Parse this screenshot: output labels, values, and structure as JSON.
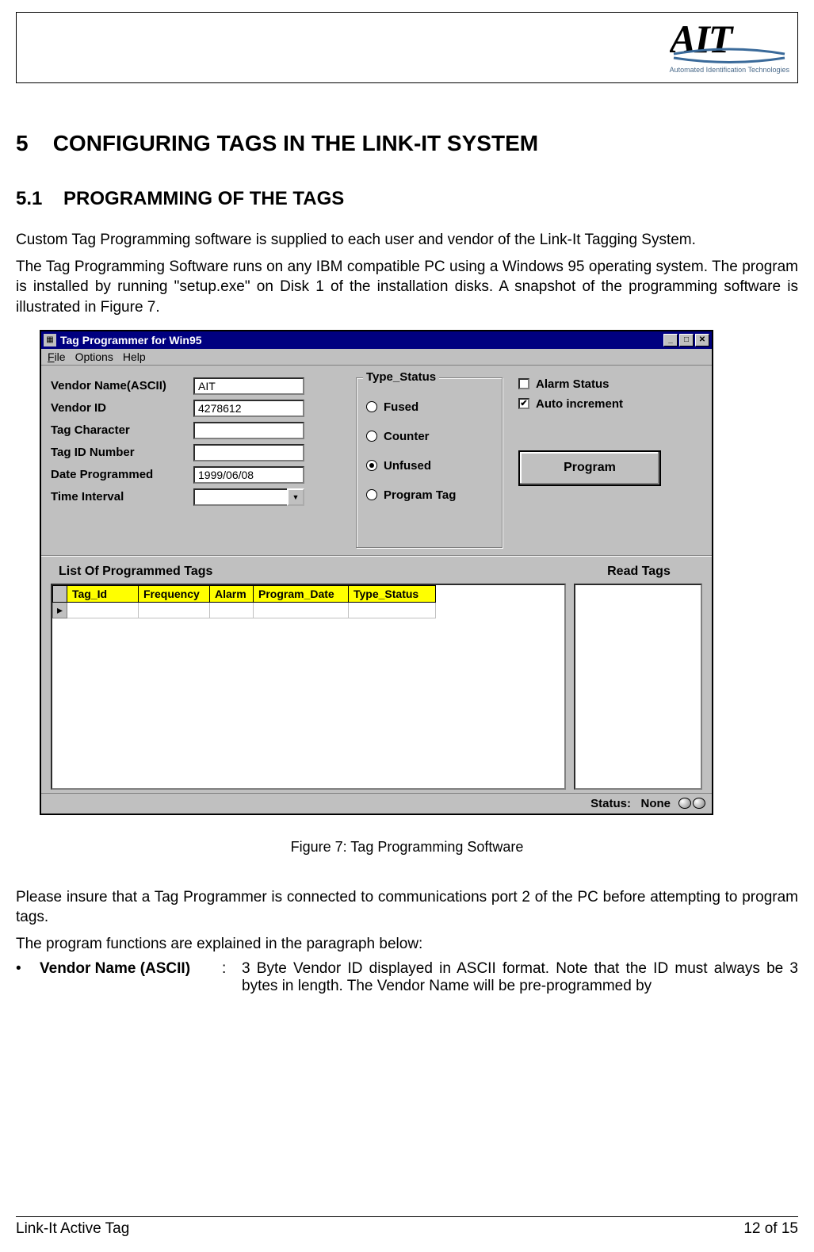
{
  "logo": {
    "main": "AIT",
    "sub": "Automated Identification Technologies"
  },
  "section": {
    "num": "5",
    "title": "CONFIGURING TAGS IN THE LINK-IT SYSTEM"
  },
  "subsection": {
    "num": "5.1",
    "title": "PROGRAMMING OF THE TAGS"
  },
  "para1": "Custom Tag Programming software is supplied to each user and vendor of the Link-It Tagging System.",
  "para2": "The Tag Programming Software runs on any IBM compatible PC using a Windows 95 operating system. The program is installed by running \"setup.exe\" on Disk 1 of the installation disks. A snapshot of the programming software is illustrated in Figure 7.",
  "app": {
    "title": "Tag Programmer for Win95",
    "menus": {
      "file": "File",
      "options": "Options",
      "help": "Help"
    },
    "fields": {
      "vendor_name_label": "Vendor Name(ASCII)",
      "vendor_name_value": "AIT",
      "vendor_id_label": "Vendor ID",
      "vendor_id_value": "4278612",
      "tag_char_label": "Tag Character",
      "tag_char_value": "",
      "tag_id_label": "Tag ID Number",
      "tag_id_value": "",
      "date_label": "Date Programmed",
      "date_value": "1999/06/08",
      "interval_label": "Time Interval",
      "interval_value": ""
    },
    "type_status": {
      "legend": "Type_Status",
      "fused": "Fused",
      "counter": "Counter",
      "unfused": "Unfused",
      "program_tag": "Program Tag",
      "selected": "Unfused"
    },
    "checks": {
      "alarm": {
        "label": "Alarm Status",
        "checked": false
      },
      "auto": {
        "label": "Auto increment",
        "checked": true
      }
    },
    "program_btn": "Program",
    "list_label": "List Of Programmed Tags",
    "read_label": "Read Tags",
    "columns": {
      "tag_id": "Tag_Id",
      "freq": "Frequency",
      "alarm": "Alarm",
      "pdate": "Program_Date",
      "tstatus": "Type_Status"
    },
    "status": {
      "label": "Status:",
      "value": "None"
    }
  },
  "caption": "Figure 7: Tag Programming Software",
  "para3": "Please insure that a Tag Programmer is connected to communications port 2 of the PC before attempting to program tags.",
  "para4": "The program functions are explained in the paragraph below:",
  "bullet": {
    "marker": "•",
    "term": "Vendor Name (ASCII)",
    "colon": ":",
    "desc": "3 Byte Vendor ID displayed in ASCII format. Note that the ID must always be 3 bytes in length. The Vendor Name will be pre-programmed by"
  },
  "footer": {
    "left": "Link-It Active Tag",
    "right": "12 of 15"
  }
}
